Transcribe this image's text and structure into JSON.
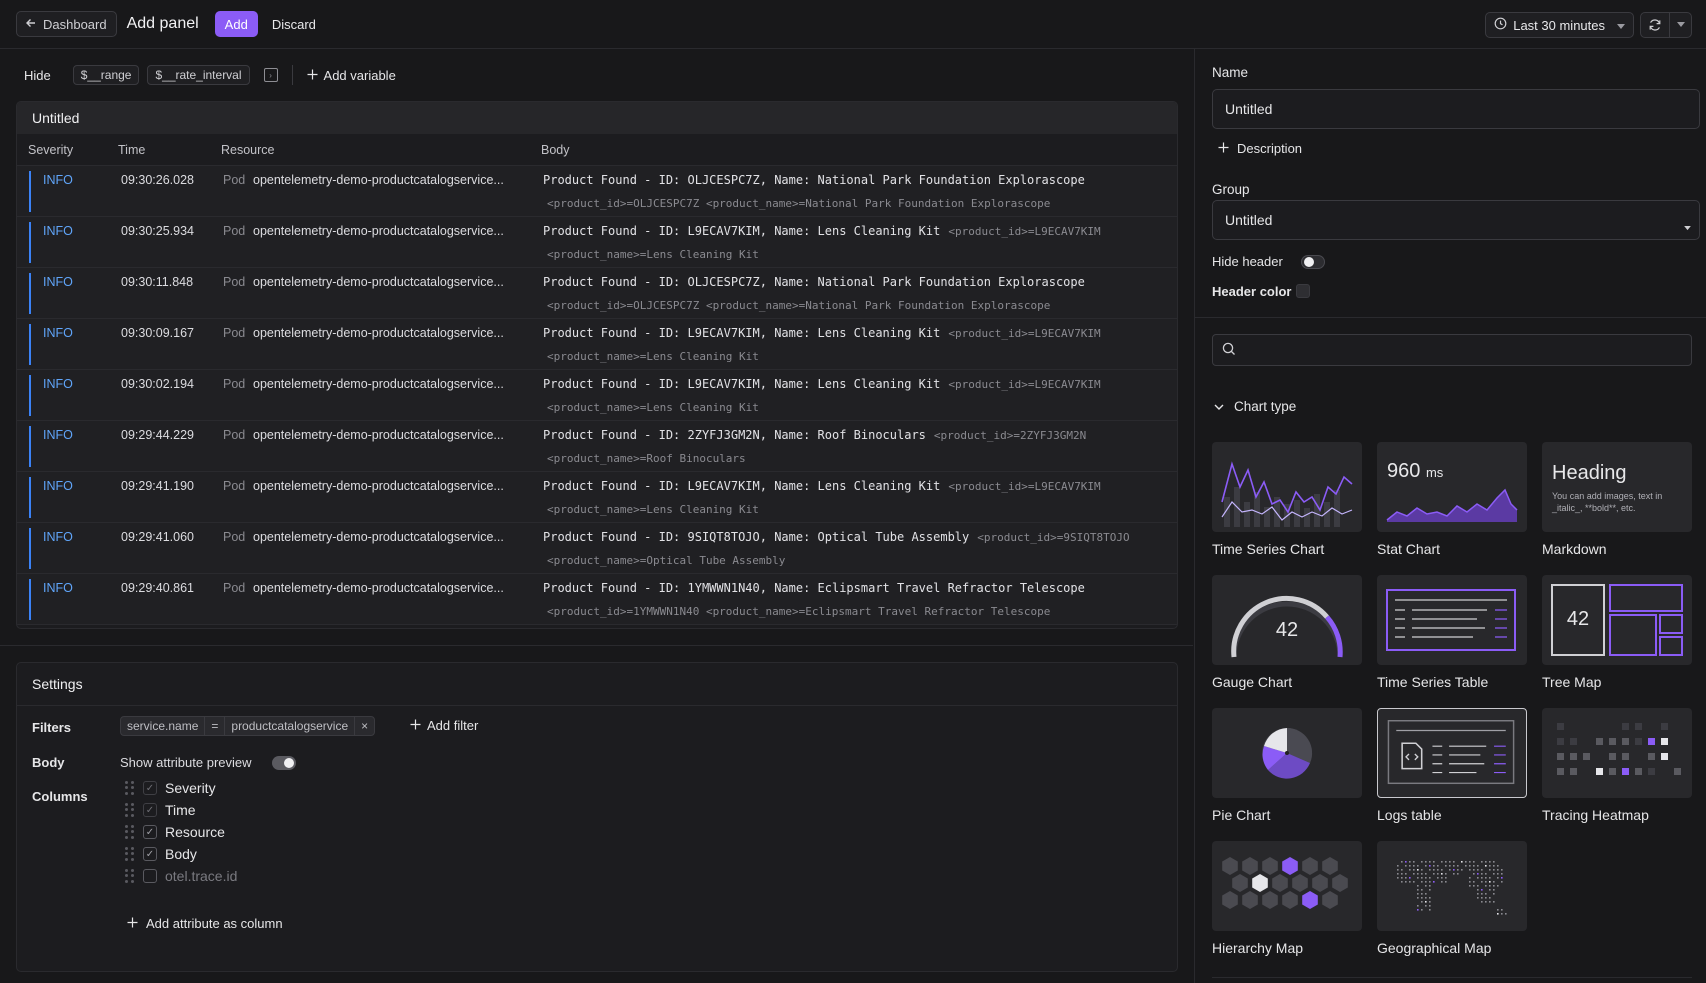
{
  "topbar": {
    "back_label": "Dashboard",
    "title": "Add panel",
    "add_label": "Add",
    "discard_label": "Discard",
    "time_range": "Last 30 minutes"
  },
  "variables": {
    "hide_label": "Hide",
    "chips": [
      "$__range",
      "$__rate_interval"
    ],
    "add_label": "Add variable"
  },
  "panel": {
    "title": "Untitled",
    "columns": [
      "Severity",
      "Time",
      "Resource",
      "Body"
    ],
    "rows": [
      {
        "severity": "INFO",
        "time": "09:30:26.028",
        "kind": "Pod",
        "resource": "opentelemetry-demo-productcatalogservice...",
        "body": "Product Found - ID: OLJCESPC7Z, Name: National Park Foundation Explorascope",
        "attr_inline": "",
        "attr_line": "<product_id>=OLJCESPC7Z <product_name>=National Park Foundation Explorascope"
      },
      {
        "severity": "INFO",
        "time": "09:30:25.934",
        "kind": "Pod",
        "resource": "opentelemetry-demo-productcatalogservice...",
        "body": "Product Found - ID: L9ECAV7KIM, Name: Lens Cleaning Kit",
        "attr_inline": "<product_id>=L9ECAV7KIM",
        "attr_line": "<product_name>=Lens Cleaning Kit"
      },
      {
        "severity": "INFO",
        "time": "09:30:11.848",
        "kind": "Pod",
        "resource": "opentelemetry-demo-productcatalogservice...",
        "body": "Product Found - ID: OLJCESPC7Z, Name: National Park Foundation Explorascope",
        "attr_inline": "",
        "attr_line": "<product_id>=OLJCESPC7Z <product_name>=National Park Foundation Explorascope"
      },
      {
        "severity": "INFO",
        "time": "09:30:09.167",
        "kind": "Pod",
        "resource": "opentelemetry-demo-productcatalogservice...",
        "body": "Product Found - ID: L9ECAV7KIM, Name: Lens Cleaning Kit",
        "attr_inline": "<product_id>=L9ECAV7KIM",
        "attr_line": "<product_name>=Lens Cleaning Kit"
      },
      {
        "severity": "INFO",
        "time": "09:30:02.194",
        "kind": "Pod",
        "resource": "opentelemetry-demo-productcatalogservice...",
        "body": "Product Found - ID: L9ECAV7KIM, Name: Lens Cleaning Kit",
        "attr_inline": "<product_id>=L9ECAV7KIM",
        "attr_line": "<product_name>=Lens Cleaning Kit"
      },
      {
        "severity": "INFO",
        "time": "09:29:44.229",
        "kind": "Pod",
        "resource": "opentelemetry-demo-productcatalogservice...",
        "body": "Product Found - ID: 2ZYFJ3GM2N, Name: Roof Binoculars",
        "attr_inline": "<product_id>=2ZYFJ3GM2N",
        "attr_line": "<product_name>=Roof Binoculars"
      },
      {
        "severity": "INFO",
        "time": "09:29:41.190",
        "kind": "Pod",
        "resource": "opentelemetry-demo-productcatalogservice...",
        "body": "Product Found - ID: L9ECAV7KIM, Name: Lens Cleaning Kit",
        "attr_inline": "<product_id>=L9ECAV7KIM",
        "attr_line": "<product_name>=Lens Cleaning Kit"
      },
      {
        "severity": "INFO",
        "time": "09:29:41.060",
        "kind": "Pod",
        "resource": "opentelemetry-demo-productcatalogservice...",
        "body": "Product Found - ID: 9SIQT8TOJO, Name: Optical Tube Assembly",
        "attr_inline": "<product_id>=9SIQT8TOJO",
        "attr_line": "<product_name>=Optical Tube Assembly"
      },
      {
        "severity": "INFO",
        "time": "09:29:40.861",
        "kind": "Pod",
        "resource": "opentelemetry-demo-productcatalogservice...",
        "body": "Product Found - ID: 1YMWWN1N40, Name: Eclipsmart Travel Refractor Telescope",
        "attr_inline": "",
        "attr_line": "<product_id>=1YMWWN1N40 <product_name>=Eclipsmart Travel Refractor Telescope"
      }
    ]
  },
  "settings": {
    "title": "Settings",
    "filters_label": "Filters",
    "filter": {
      "key": "service.name",
      "op": "=",
      "value": "productcatalogservice",
      "remove": "×"
    },
    "add_filter_label": "Add filter",
    "body_label": "Body",
    "attr_preview_label": "Show attribute preview",
    "columns_label": "Columns",
    "columns": [
      {
        "label": "Severity",
        "checked": true,
        "dim": true
      },
      {
        "label": "Time",
        "checked": true,
        "dim": true
      },
      {
        "label": "Resource",
        "checked": true,
        "dim": false
      },
      {
        "label": "Body",
        "checked": true,
        "dim": false
      },
      {
        "label": "otel.trace.id",
        "checked": false,
        "dim": false
      }
    ],
    "add_attr_label": "Add attribute as column"
  },
  "sidebar": {
    "name_label": "Name",
    "name_value": "Untitled",
    "description_label": "Description",
    "group_label": "Group",
    "group_value": "Untitled",
    "hide_header_label": "Hide header",
    "header_color_label": "Header color",
    "search_placeholder": "",
    "chart_type_label": "Chart type",
    "charts": [
      {
        "name": "Time Series Chart"
      },
      {
        "name": "Stat Chart",
        "value": "960",
        "unit": "ms"
      },
      {
        "name": "Markdown",
        "heading": "Heading",
        "text": "You can add images, text in _italic_, **bold**, etc."
      },
      {
        "name": "Gauge Chart",
        "value": "42"
      },
      {
        "name": "Time Series Table"
      },
      {
        "name": "Tree Map",
        "value": "42"
      },
      {
        "name": "Pie Chart"
      },
      {
        "name": "Logs table"
      },
      {
        "name": "Tracing Heatmap"
      },
      {
        "name": "Hierarchy Map"
      },
      {
        "name": "Geographical Map"
      }
    ],
    "selected_chart": "Logs table"
  },
  "colors": {
    "accent": "#8b5cf6",
    "info": "#60a5fa",
    "background": "#18181a"
  }
}
